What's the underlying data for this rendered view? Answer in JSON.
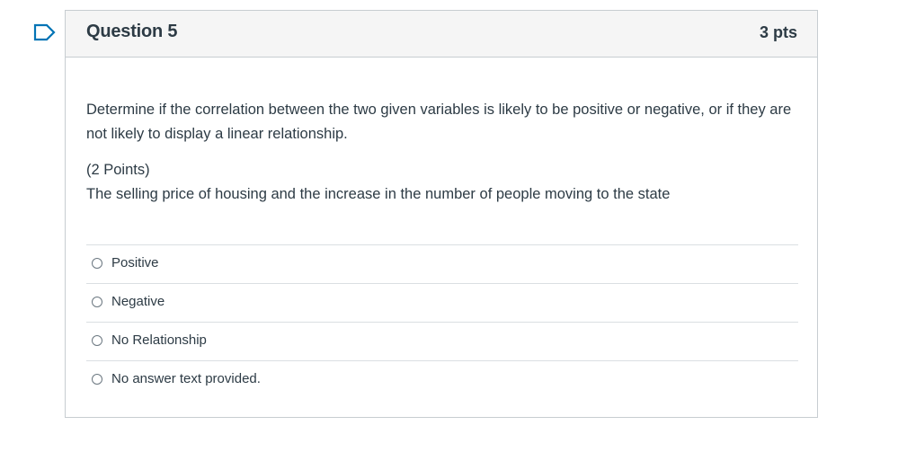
{
  "question": {
    "title": "Question 5",
    "points": "3 pts",
    "prompt": "Determine if the correlation between the two given variables is likely to be positive or negative, or if they are not likely to display a linear relationship.",
    "points_note": "(2 Points)",
    "scenario": "The selling price of housing and the increase in the number of people moving to the state",
    "answers": [
      {
        "label": "Positive"
      },
      {
        "label": "Negative"
      },
      {
        "label": "No Relationship"
      },
      {
        "label": "No answer text provided."
      }
    ]
  },
  "colors": {
    "accent": "#0374b5",
    "text": "#2d3b45",
    "border": "#c7cdd1",
    "header_bg": "#f5f5f5"
  },
  "icons": {
    "flag": "bookmark-flag-icon"
  }
}
